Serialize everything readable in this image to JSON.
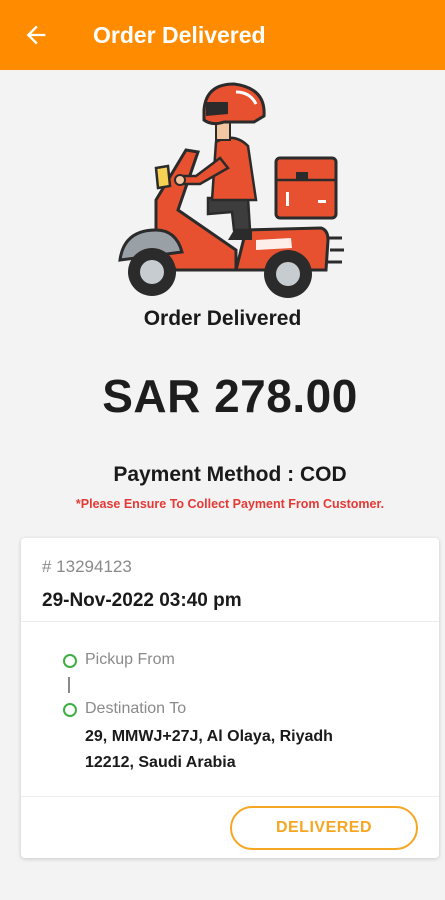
{
  "app_bar": {
    "title": "Order Delivered",
    "back_icon": "arrow-left-icon",
    "background_color": "#ff8c00"
  },
  "hero": {
    "illustration": "delivery-scooter-rider-icon",
    "status_label": "Order Delivered"
  },
  "amount": "SAR 278.00",
  "payment": {
    "method_label": "Payment Method : COD",
    "warning": "*Please Ensure To Collect Payment From Customer.",
    "warning_color": "#e53935"
  },
  "order": {
    "id": "# 13294123",
    "datetime": "29-Nov-2022 03:40 pm",
    "pickup_label": "Pickup From",
    "destination_label": "Destination To",
    "destination_line1": "29, MMWJ+27J, Al Olaya, Riyadh",
    "destination_line2": "12212, Saudi Arabia",
    "status_button": "DELIVERED",
    "status_color": "#f5a623",
    "route_dot_color": "#3cb043"
  }
}
